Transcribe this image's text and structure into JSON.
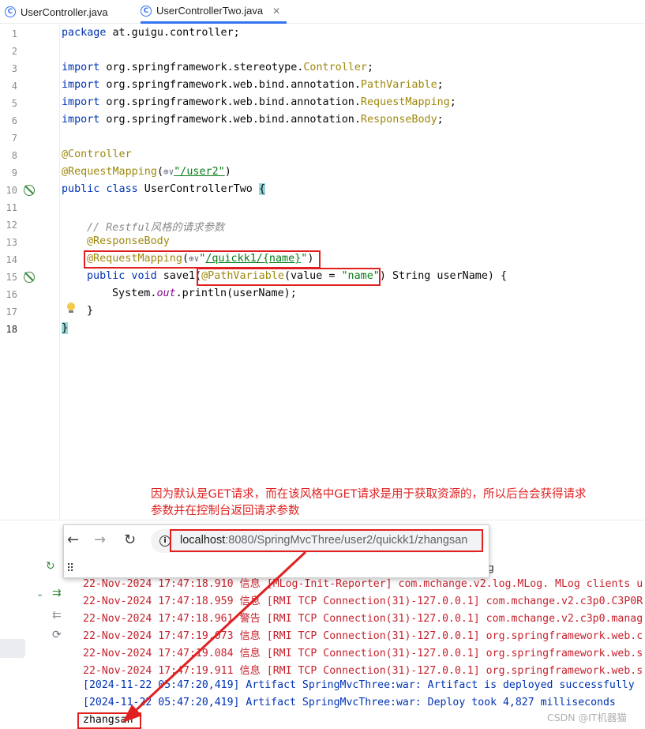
{
  "tabs": [
    {
      "icon": "class-icon",
      "label": "UserController.java",
      "active": false
    },
    {
      "icon": "class-icon",
      "label": "UserControllerTwo.java",
      "active": true
    }
  ],
  "editor": {
    "line_numbers": [
      "1",
      "2",
      "3",
      "4",
      "5",
      "6",
      "7",
      "8",
      "9",
      "10",
      "11",
      "12",
      "13",
      "14",
      "15",
      "16",
      "17",
      "18"
    ],
    "lines": {
      "l1_kw": "package",
      "l1_rest": " at.guigu.controller;",
      "l3_kw": "import",
      "l3_pkg": " org.springframework.stereotype.",
      "l3_cls": "Controller",
      "l3_end": ";",
      "l4_kw": "import",
      "l4_pkg": " org.springframework.web.bind.annotation.",
      "l4_cls": "PathVariable",
      "l4_end": ";",
      "l5_kw": "import",
      "l5_pkg": " org.springframework.web.bind.annotation.",
      "l5_cls": "RequestMapping",
      "l5_end": ";",
      "l6_kw": "import",
      "l6_pkg": " org.springframework.web.bind.annotation.",
      "l6_cls": "ResponseBody",
      "l6_end": ";",
      "l8_ann": "@Controller",
      "l9_ann": "@RequestMapping",
      "l9_open": "(",
      "l9_globe": "⊕∨",
      "l9_str": "\"/user2\"",
      "l9_close": ")",
      "l10_kw": "public class",
      "l10_name": " UserControllerTwo ",
      "l10_brace": "{",
      "l12_cmt": "// Restful风格的请求参数",
      "l13_ann": "@ResponseBody",
      "l14_ann": "@RequestMapping",
      "l14_open": "(",
      "l14_globe": "⊕∨",
      "l14_str_a": "\"",
      "l14_url": "/quickk1/{name}",
      "l14_str_b": "\"",
      "l14_close": ")",
      "l15_kw": "public void",
      "l15_name": " save1(",
      "l15_ann": "@PathVariable",
      "l15_val": "(value = ",
      "l15_str": "\"name\"",
      "l15_rest": ") String userName) {",
      "l16_a": "System.",
      "l16_fld": "out",
      "l16_b": ".println(userName);",
      "l17": "}",
      "l18": "}"
    }
  },
  "annotation": {
    "line1": "因为默认是GET请求，而在该风格中GET请求是用于获取资源的，所以后台会获得请求",
    "line2": "参数并在控制台返回请求参数"
  },
  "browser": {
    "back": "←",
    "forward": "→",
    "reload": "↻",
    "url_host": "localhost",
    "url_rest": ":8080/SpringMvcThree/user2/quickk1/zhangsan",
    "apps_icon": "⠿"
  },
  "console": {
    "lines": [
      {
        "style": "red",
        "text": "22-Nov-2024 17:47:18.910 信息 [MLog-Init-Reporter] com.mchange.v2.log.MLog. MLog clients u"
      },
      {
        "style": "red",
        "text": "22-Nov-2024 17:47:18.959 信息 [RMI TCP Connection(31)-127.0.0.1] com.mchange.v2.c3p0.C3P0R"
      },
      {
        "style": "red",
        "text": "22-Nov-2024 17:47:18.961 警告 [RMI TCP Connection(31)-127.0.0.1] com.mchange.v2.c3p0.manag"
      },
      {
        "style": "red",
        "text": "22-Nov-2024 17:47:19.073 信息 [RMI TCP Connection(31)-127.0.0.1] org.springframework.web.c"
      },
      {
        "style": "red",
        "text": "22-Nov-2024 17:47:19.084 信息 [RMI TCP Connection(31)-127.0.0.1] org.springframework.web.s"
      },
      {
        "style": "red",
        "text": "22-Nov-2024 17:47:19.911 信息 [RMI TCP Connection(31)-127.0.0.1] org.springframework.web.s"
      },
      {
        "style": "blue",
        "text": "[2024-11-22 05:47:20,419] Artifact SpringMvcThree:war: Artifact is deployed successfully"
      },
      {
        "style": "blue",
        "text": "[2024-11-22 05:47:20,419] Artifact SpringMvcThree:war: Deploy took 4,827 milliseconds"
      },
      {
        "style": "out",
        "text": "zhangsan"
      }
    ],
    "header_fragment": "og"
  },
  "watermark": "CSDN @IT机器猫",
  "colors": {
    "keyword": "#0033b3",
    "annotation": "#9e880d",
    "string": "#067d17",
    "error_red": "#c7222d",
    "highlight_box": "#e02020",
    "accent": "#3574f0"
  }
}
